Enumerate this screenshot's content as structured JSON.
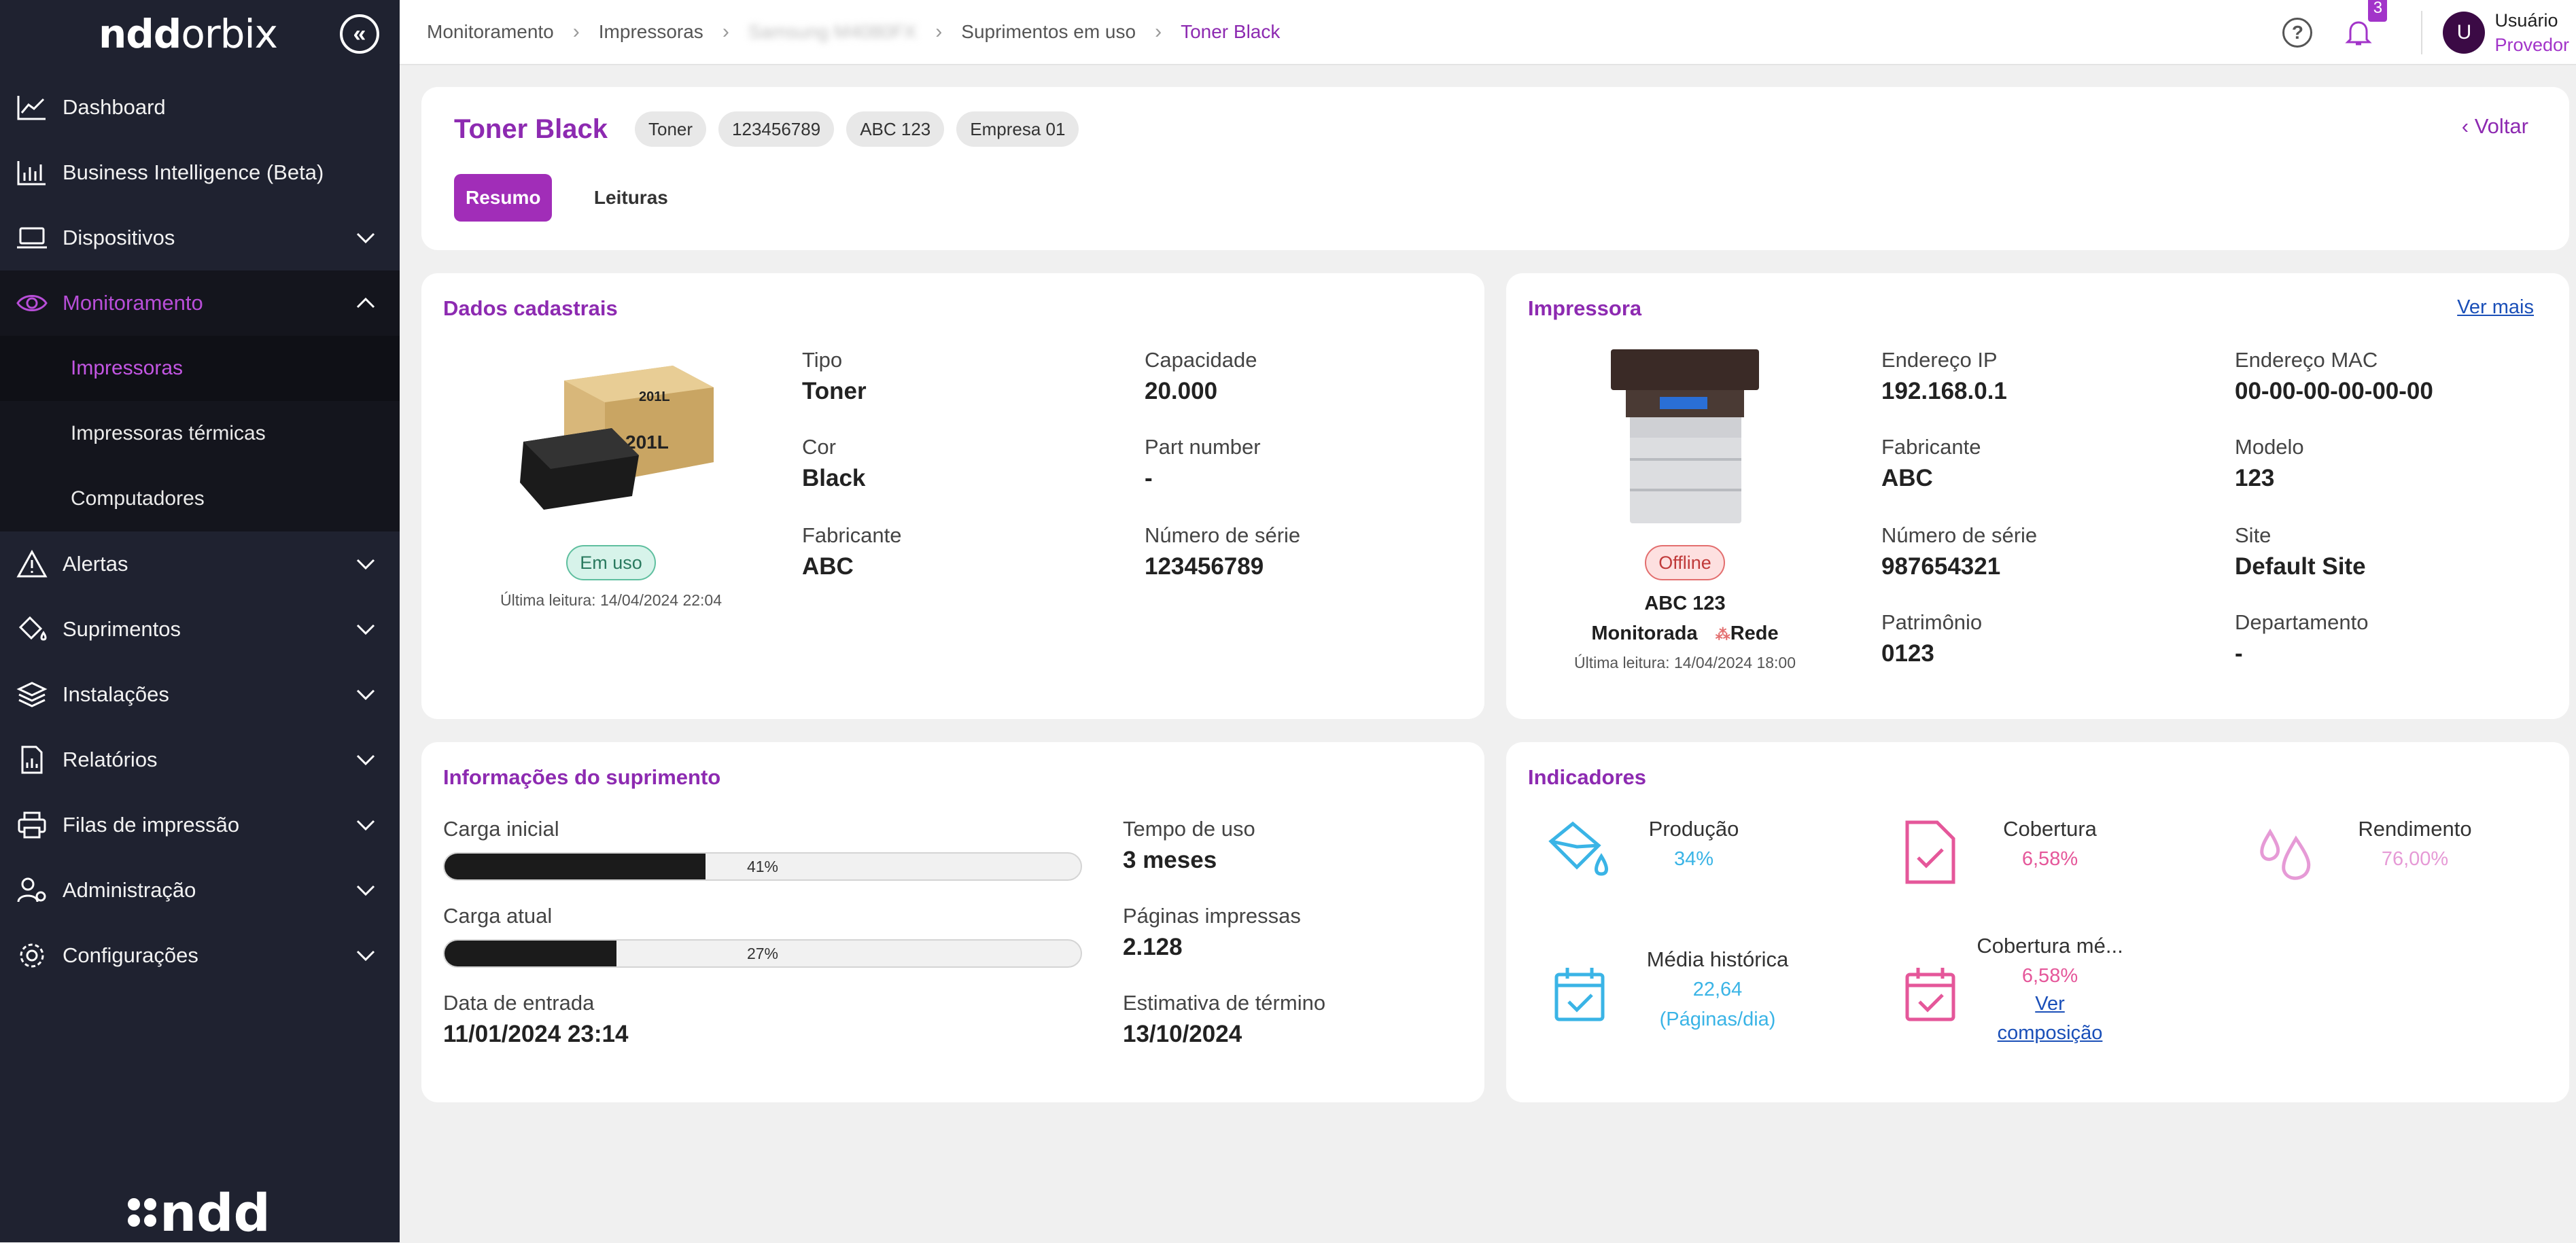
{
  "sidebar": {
    "logo_bold": "ndd",
    "logo_thin": "orbix",
    "items": [
      {
        "label": "Dashboard"
      },
      {
        "label": "Business Intelligence (Beta)"
      },
      {
        "label": "Dispositivos"
      },
      {
        "label": "Monitoramento"
      },
      {
        "label": "Alertas"
      },
      {
        "label": "Suprimentos"
      },
      {
        "label": "Instalações"
      },
      {
        "label": "Relatórios"
      },
      {
        "label": "Filas de impressão"
      },
      {
        "label": "Administração"
      },
      {
        "label": "Configurações"
      }
    ],
    "sub_items": [
      {
        "label": "Impressoras"
      },
      {
        "label": "Impressoras térmicas"
      },
      {
        "label": "Computadores"
      }
    ],
    "footer_logo": "ndd"
  },
  "breadcrumb": {
    "items": [
      "Monitoramento",
      "Impressoras",
      "Samsung M4080FX",
      "Suprimentos em uso",
      "Toner Black"
    ]
  },
  "header": {
    "notification_count": "3",
    "avatar_letter": "U",
    "user_name": "Usuário",
    "user_role": "Provedor"
  },
  "summary": {
    "title": "Toner Black",
    "chips": [
      "Toner",
      "123456789",
      "ABC 123",
      "Empresa 01"
    ],
    "back_label": "Voltar",
    "tabs": [
      "Resumo",
      "Leituras"
    ]
  },
  "dados": {
    "title": "Dados cadastrais",
    "status": "Em uso",
    "last_read": "Última leitura: 14/04/2024 22:04",
    "fields": [
      {
        "label": "Tipo",
        "value": "Toner"
      },
      {
        "label": "Capacidade",
        "value": "20.000"
      },
      {
        "label": "Cor",
        "value": "Black"
      },
      {
        "label": "Part number",
        "value": "-"
      },
      {
        "label": "Fabricante",
        "value": "ABC"
      },
      {
        "label": "Número de série",
        "value": "123456789"
      }
    ]
  },
  "impressora": {
    "title": "Impressora",
    "ver_mais": "Ver mais",
    "status": "Offline",
    "model_name": "ABC 123",
    "monitor_label": "Monitorada",
    "network_label": "Rede",
    "last_read": "Última leitura: 14/04/2024 18:00",
    "fields": [
      {
        "label": "Endereço IP",
        "value": "192.168.0.1"
      },
      {
        "label": "Endereço MAC",
        "value": "00-00-00-00-00-00"
      },
      {
        "label": "Fabricante",
        "value": "ABC"
      },
      {
        "label": "Modelo",
        "value": "123"
      },
      {
        "label": "Número de série",
        "value": "987654321"
      },
      {
        "label": "Site",
        "value": "Default Site"
      },
      {
        "label": "Patrimônio",
        "value": "0123"
      },
      {
        "label": "Departamento",
        "value": "-"
      }
    ]
  },
  "suprimento": {
    "title": "Informações do suprimento",
    "carga_inicial_label": "Carga inicial",
    "carga_inicial_pct": "41%",
    "carga_inicial_value": 41,
    "carga_atual_label": "Carga atual",
    "carga_atual_pct": "27%",
    "carga_atual_value": 27,
    "data_entrada_label": "Data de entrada",
    "data_entrada_value": "11/01/2024 23:14",
    "tempo_uso_label": "Tempo de uso",
    "tempo_uso_value": "3 meses",
    "paginas_label": "Páginas impressas",
    "paginas_value": "2.128",
    "estimativa_label": "Estimativa de término",
    "estimativa_value": "13/10/2024"
  },
  "indicadores": {
    "title": "Indicadores",
    "producao_label": "Produção",
    "producao_value": "34%",
    "cobertura_label": "Cobertura",
    "cobertura_value": "6,58%",
    "rendimento_label": "Rendimento",
    "rendimento_value": "76,00%",
    "media_label": "Média histórica",
    "media_value": "22,64",
    "media_unit": "(Páginas/dia)",
    "cobertura_media_label": "Cobertura mé...",
    "cobertura_media_value": "6,58%",
    "ver_composicao_1": "Ver",
    "ver_composicao_2": "composição",
    "colors": {
      "blue": "#3ab4e6",
      "pink": "#e5579a",
      "light_pink": "#e69ad6"
    }
  }
}
